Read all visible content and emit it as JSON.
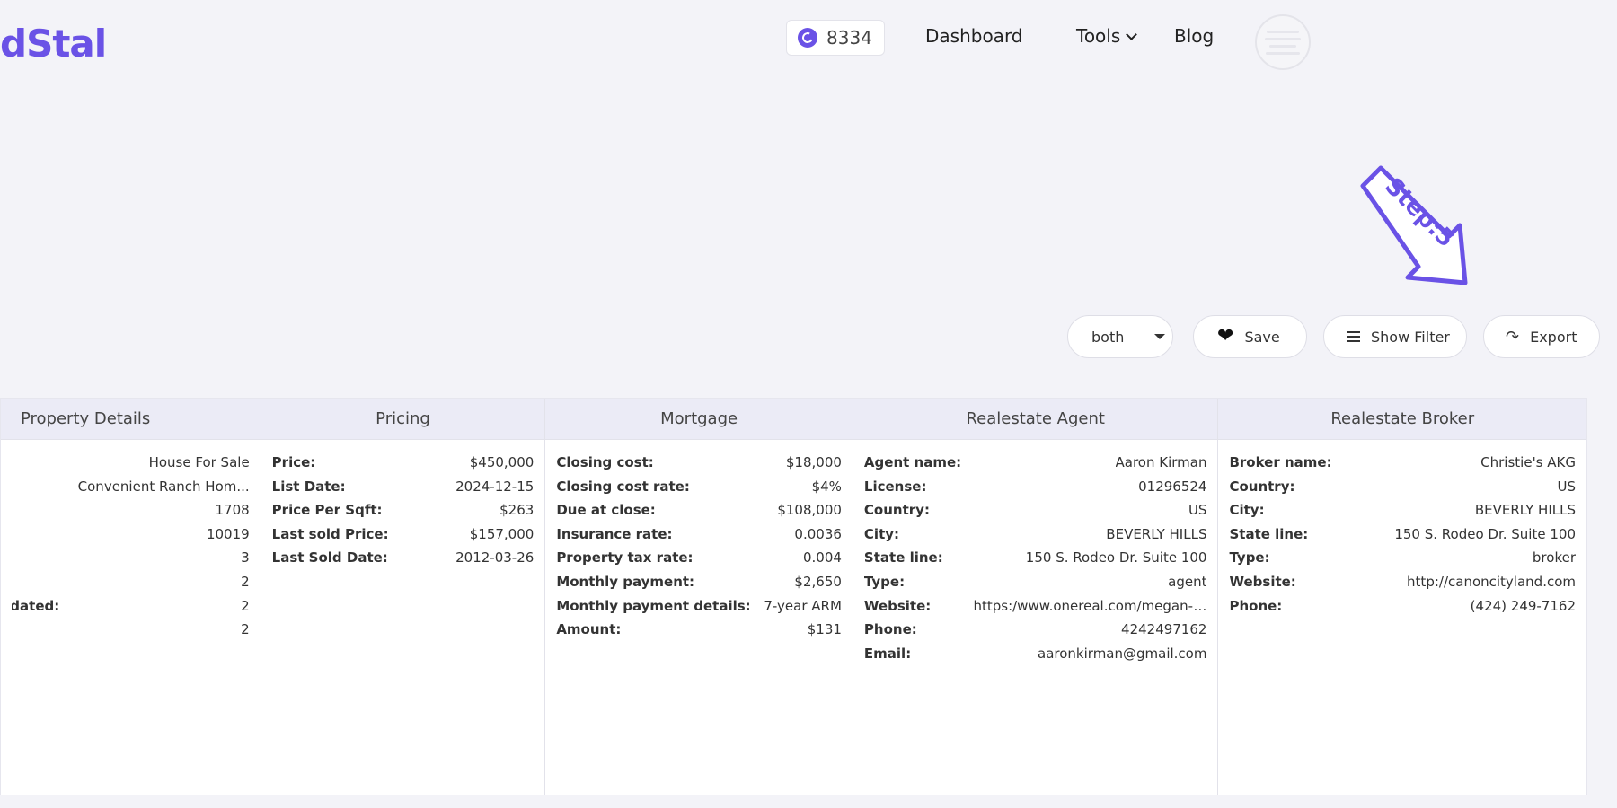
{
  "header": {
    "logo_text": "dStal",
    "credits": "8334",
    "nav": {
      "dashboard": "Dashboard",
      "tools": "Tools",
      "blog": "Blog"
    }
  },
  "annotation": {
    "step_label": "Step:5"
  },
  "toolbar": {
    "mode_select": "both",
    "save_label": "Save",
    "filter_label": "Show Filter",
    "export_label": "Export"
  },
  "table": {
    "property": {
      "title": "Property Details",
      "rows": [
        {
          "k": "",
          "v": "House For Sale"
        },
        {
          "k": "",
          "v": "Convenient Ranch Hom..."
        },
        {
          "k": "",
          "v": "1708"
        },
        {
          "k": "",
          "v": "10019"
        },
        {
          "k": "",
          "v": "3"
        },
        {
          "k": "",
          "v": "2"
        },
        {
          "k": "ildated:",
          "v": "2"
        },
        {
          "k": "",
          "v": "2"
        }
      ]
    },
    "pricing": {
      "title": "Pricing",
      "rows": [
        {
          "k": "Price:",
          "v": "$450,000"
        },
        {
          "k": "List Date:",
          "v": "2024-12-15"
        },
        {
          "k": "Price Per Sqft:",
          "v": "$263"
        },
        {
          "k": "Last sold Price:",
          "v": "$157,000"
        },
        {
          "k": "Last Sold Date:",
          "v": "2012-03-26"
        }
      ]
    },
    "mortgage": {
      "title": "Mortgage",
      "rows": [
        {
          "k": "Closing cost:",
          "v": "$18,000"
        },
        {
          "k": "Closing cost rate:",
          "v": "$4%"
        },
        {
          "k": "Due at close:",
          "v": "$108,000"
        },
        {
          "k": "Insurance rate:",
          "v": "0.0036"
        },
        {
          "k": "Property tax rate:",
          "v": "0.004"
        },
        {
          "k": "Monthly payment:",
          "v": "$2,650"
        },
        {
          "k": "Monthly payment details:",
          "v": "7-year ARM"
        },
        {
          "k": "Amount:",
          "v": "$131"
        }
      ]
    },
    "agent": {
      "title": "Realestate Agent",
      "rows": [
        {
          "k": "Agent name:",
          "v": "Aaron Kirman"
        },
        {
          "k": "License:",
          "v": "01296524"
        },
        {
          "k": "Country:",
          "v": "US"
        },
        {
          "k": "City:",
          "v": "BEVERLY HILLS"
        },
        {
          "k": "State line:",
          "v": "150 S. Rodeo Dr. Suite 100"
        },
        {
          "k": "Type:",
          "v": "agent"
        },
        {
          "k": "Website:",
          "v": "https:/www.onereal.com/megan-o..."
        },
        {
          "k": "Phone:",
          "v": "4242497162"
        },
        {
          "k": "Email:",
          "v": "aaronkirman@gmail.com"
        }
      ]
    },
    "broker": {
      "title": "Realestate Broker",
      "rows": [
        {
          "k": "Broker name:",
          "v": "Christie's AKG"
        },
        {
          "k": "Country:",
          "v": "US"
        },
        {
          "k": "City:",
          "v": "BEVERLY HILLS"
        },
        {
          "k": "State line:",
          "v": "150 S. Rodeo Dr. Suite 100"
        },
        {
          "k": "Type:",
          "v": "broker"
        },
        {
          "k": "Website:",
          "v": "http://canoncityland.com"
        },
        {
          "k": "Phone:",
          "v": "(424) 249-7162"
        }
      ]
    }
  }
}
